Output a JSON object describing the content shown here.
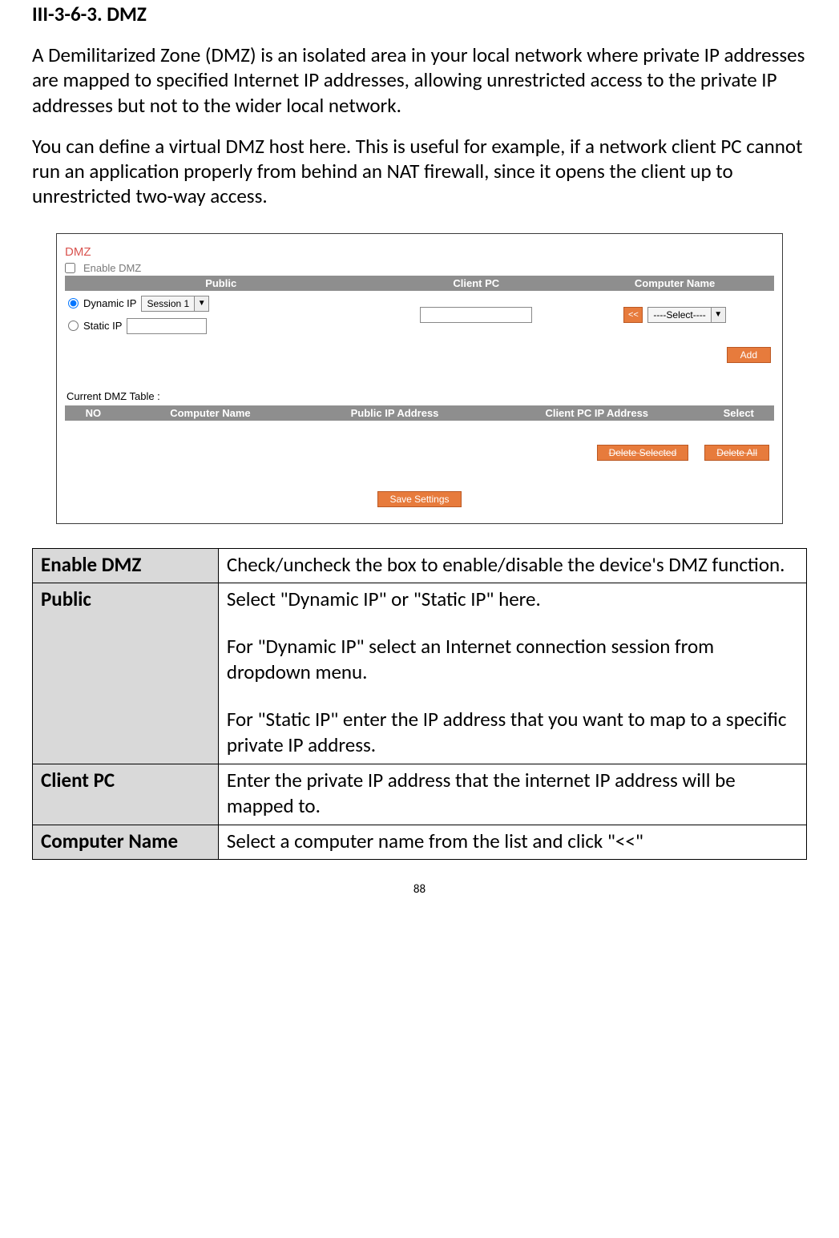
{
  "heading": "III-3-6-3.    DMZ",
  "para1": "A Demilitarized Zone (DMZ) is an isolated area in your local network where private IP addresses are mapped to specified Internet IP addresses, allowing unrestricted access to the private IP addresses but not to the wider local network.",
  "para2": "You can define a virtual DMZ host here. This is useful for example, if a network client PC cannot run an application properly from behind an NAT firewall, since it opens the client up to unrestricted two-way access.",
  "screenshot": {
    "title": "DMZ",
    "enable_label": "Enable  DMZ",
    "headers": {
      "public": "Public",
      "client": "Client PC",
      "computer": "Computer Name"
    },
    "dynamic_ip_label": "Dynamic IP",
    "session_selected": "Session  1",
    "static_ip_label": "Static IP",
    "assign_label": "<<",
    "computer_selected": "----Select----",
    "add_label": "Add",
    "current_table_label": "Current DMZ Table :",
    "headers2": {
      "no": "NO",
      "computer": "Computer Name",
      "public": "Public  IP Address",
      "client": "Client PC  IP Address",
      "select": "Select"
    },
    "delete_selected": "Delete Selected",
    "delete_all": "Delete All",
    "save": "Save Settings"
  },
  "desc": {
    "rows": [
      {
        "key": "Enable DMZ",
        "val": "Check/uncheck the box to enable/disable the device's DMZ function."
      },
      {
        "key": "Public",
        "val_p1": "Select \"Dynamic IP\" or \"Static IP\" here.",
        "val_p2": "For \"Dynamic IP\" select an Internet connection session from dropdown menu.",
        "val_p3": "For \"Static IP\" enter the IP address that you want to map to a specific private IP address."
      },
      {
        "key": "Client PC",
        "val": "Enter the private IP address that the internet IP address will be mapped to."
      },
      {
        "key": "Computer Name",
        "val": "Select a computer name from the list and click \"<<\""
      }
    ]
  },
  "page_number": "88"
}
